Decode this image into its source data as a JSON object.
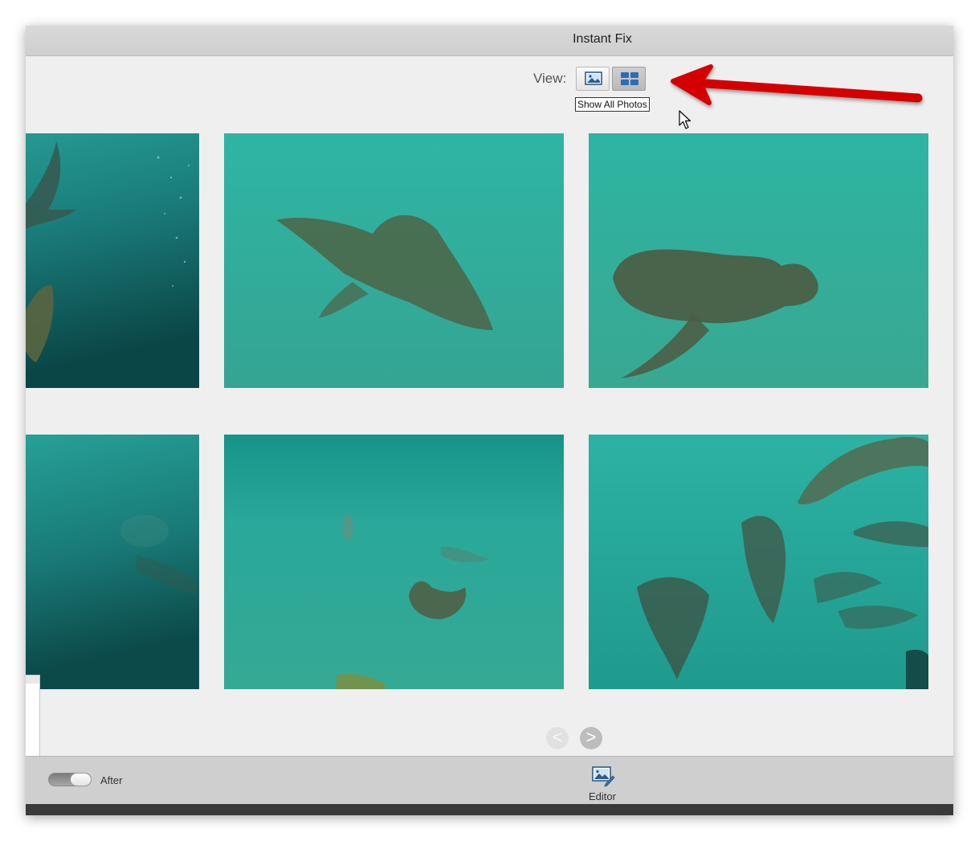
{
  "window": {
    "title": "Instant Fix"
  },
  "view": {
    "label": "View:",
    "single_icon": "single-photo-icon",
    "grid_icon": "grid-view-icon",
    "tooltip": "Show All Photos"
  },
  "photos": [
    {
      "subject": "sea lions swimming near surface"
    },
    {
      "subject": "sea lion gliding over sandy bottom"
    },
    {
      "subject": "sea lion resting on sandy bottom"
    },
    {
      "subject": "faint sea lion in murky water"
    },
    {
      "subject": "sea lions on sandy seabed"
    },
    {
      "subject": "group of sea lions swimming"
    }
  ],
  "pager": {
    "prev_icon": "chevron-left-icon",
    "next_icon": "chevron-right-icon",
    "prev": "<",
    "next": ">"
  },
  "bottom": {
    "toggle_label": "After",
    "editor_label": "Editor",
    "editor_icon": "editor-icon"
  },
  "annotation": {
    "arrow_color": "#d40000"
  },
  "colors": {
    "water_light": "#2fb3a4",
    "water_dark": "#0c4f4f",
    "sea_lion": "#4b5a44"
  }
}
